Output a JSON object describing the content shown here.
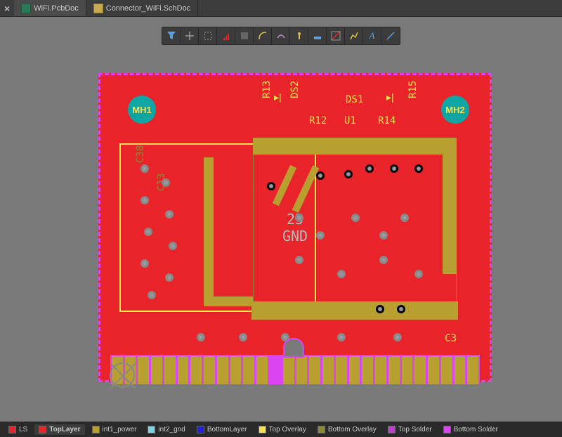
{
  "tabs": {
    "active": "WiFi.PcbDoc",
    "inactive": "Connector_WiFi.SchDoc"
  },
  "board": {
    "mount_holes": [
      "MH1",
      "MH2"
    ],
    "center_net": "25\nGND",
    "designators": {
      "ds1": "DS1",
      "ds2": "DS2",
      "u1": "U1",
      "r12": "R12",
      "r13": "R13",
      "r14": "R14",
      "r15": "R15",
      "c3": "C3",
      "c38": "C38",
      "c13": "C13"
    }
  },
  "layers": [
    {
      "name": "LS",
      "color": "#e8232a"
    },
    {
      "name": "TopLayer",
      "color": "#e8232a"
    },
    {
      "name": "int1_power",
      "color": "#b8a030"
    },
    {
      "name": "int2_gnd",
      "color": "#7dd3e0"
    },
    {
      "name": "BottomLayer",
      "color": "#2020e0"
    },
    {
      "name": "Top Overlay",
      "color": "#f5e050"
    },
    {
      "name": "Bottom Overlay",
      "color": "#8a8a30"
    },
    {
      "name": "Top Solder",
      "color": "#c040d0"
    },
    {
      "name": "Bottom Solder",
      "color": "#d946ef"
    }
  ],
  "toolbar_icons": [
    "filter-icon",
    "place-pad-icon",
    "place-via-icon",
    "place-track-icon",
    "place-fill-icon",
    "place-arc-icon",
    "move-icon",
    "keepout-icon",
    "dimension-icon",
    "layer-stack-icon",
    "measure-icon",
    "text-icon",
    "line-icon"
  ]
}
